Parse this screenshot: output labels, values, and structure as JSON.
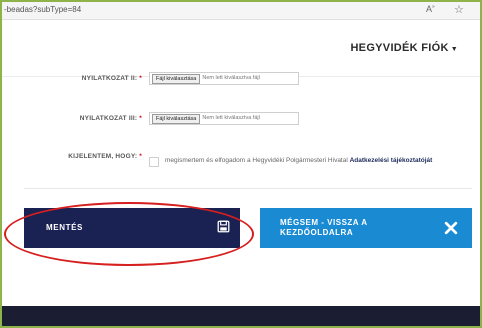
{
  "browser": {
    "url": "-beadas?subType=84",
    "reader_label": "A",
    "star_icon": "star-icon"
  },
  "header": {
    "account_label": "HEGYVIDÉK FIÓK"
  },
  "form": {
    "rows": [
      {
        "label": "NYILATKOZAT II:",
        "required": "*",
        "file_button": "Fájl kiválasztása",
        "file_status": "Nem lett kiválasztva fájl"
      },
      {
        "label": "NYILATKOZAT III:",
        "required": "*",
        "file_button": "Fájl kiválasztása",
        "file_status": "Nem lett kiválasztva fájl"
      }
    ],
    "declare": {
      "label": "KIJELENTEM, HOGY:",
      "required": "*",
      "text": "megismertem és elfogadom a Hegyvidéki Polgármesteri Hivatal ",
      "link": "Adatkezelési tájékoztatóját",
      "checked": false
    }
  },
  "actions": {
    "save_label": "MENTÉS",
    "save_icon": "floppy-disk-icon",
    "cancel_label": "MÉGSEM - VISSZA A KEZDŐOLDALRA",
    "cancel_icon": "close-x-icon"
  },
  "colors": {
    "save_bg": "#1a2153",
    "cancel_bg": "#1a8bd3",
    "highlight": "#d61f1f",
    "frame": "#8db34a",
    "required": "#d0021b",
    "footer": "#1b1d33"
  }
}
